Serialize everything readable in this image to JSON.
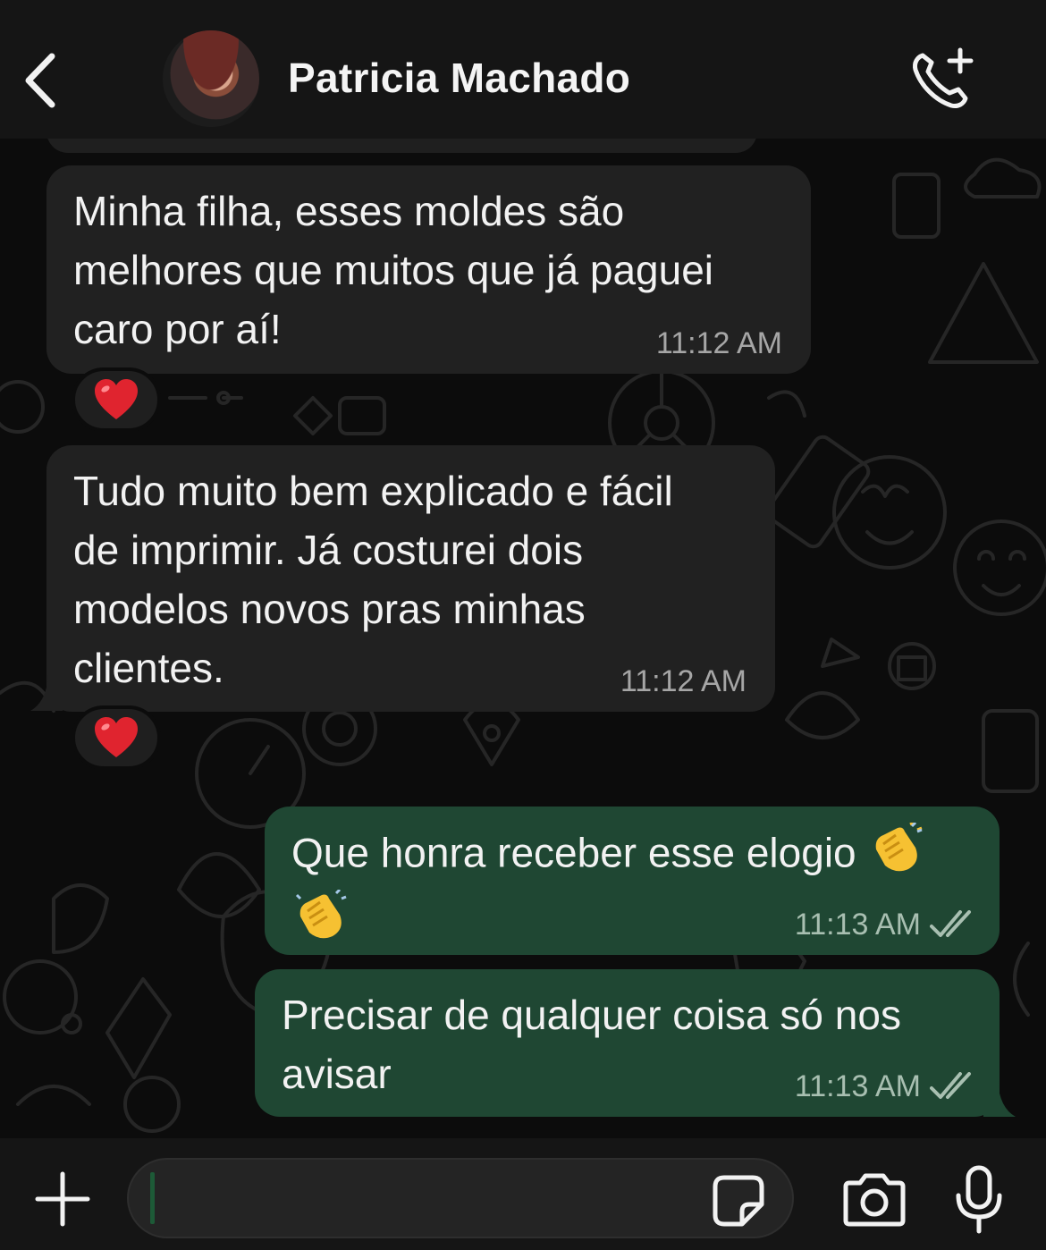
{
  "header": {
    "contact_name": "Patricia Machado",
    "back_icon": "chevron-left-icon",
    "call_icon": "phone-plus-icon"
  },
  "messages": [
    {
      "direction": "incoming",
      "text_lines": [
        "Minha filha, esses moldes são",
        "melhores que muitos que já paguei",
        "caro por aí!"
      ],
      "time": "11:12 AM",
      "reaction": "❤️"
    },
    {
      "direction": "incoming",
      "text_lines": [
        "Tudo muito bem explicado e fácil",
        "de imprimir. Já costurei dois",
        "modelos novos pras minhas",
        "clientes."
      ],
      "time": "11:12 AM",
      "reaction": "❤️"
    },
    {
      "direction": "outgoing",
      "text": "Que honra receber esse elogio",
      "emoji": "👏👏",
      "time": "11:13 AM",
      "status": "read"
    },
    {
      "direction": "outgoing",
      "text_lines": [
        "Precisar de qualquer coisa só nos",
        "avisar"
      ],
      "time": "11:13 AM",
      "status": "read"
    }
  ],
  "composer": {
    "value": "",
    "placeholder": "",
    "icons": [
      "plus-icon",
      "sticker-icon",
      "camera-icon",
      "microphone-icon"
    ]
  },
  "colors": {
    "incoming_bubble": "#212121",
    "outgoing_bubble": "#1f4733",
    "background": "#0c0c0c",
    "header": "#151515"
  }
}
